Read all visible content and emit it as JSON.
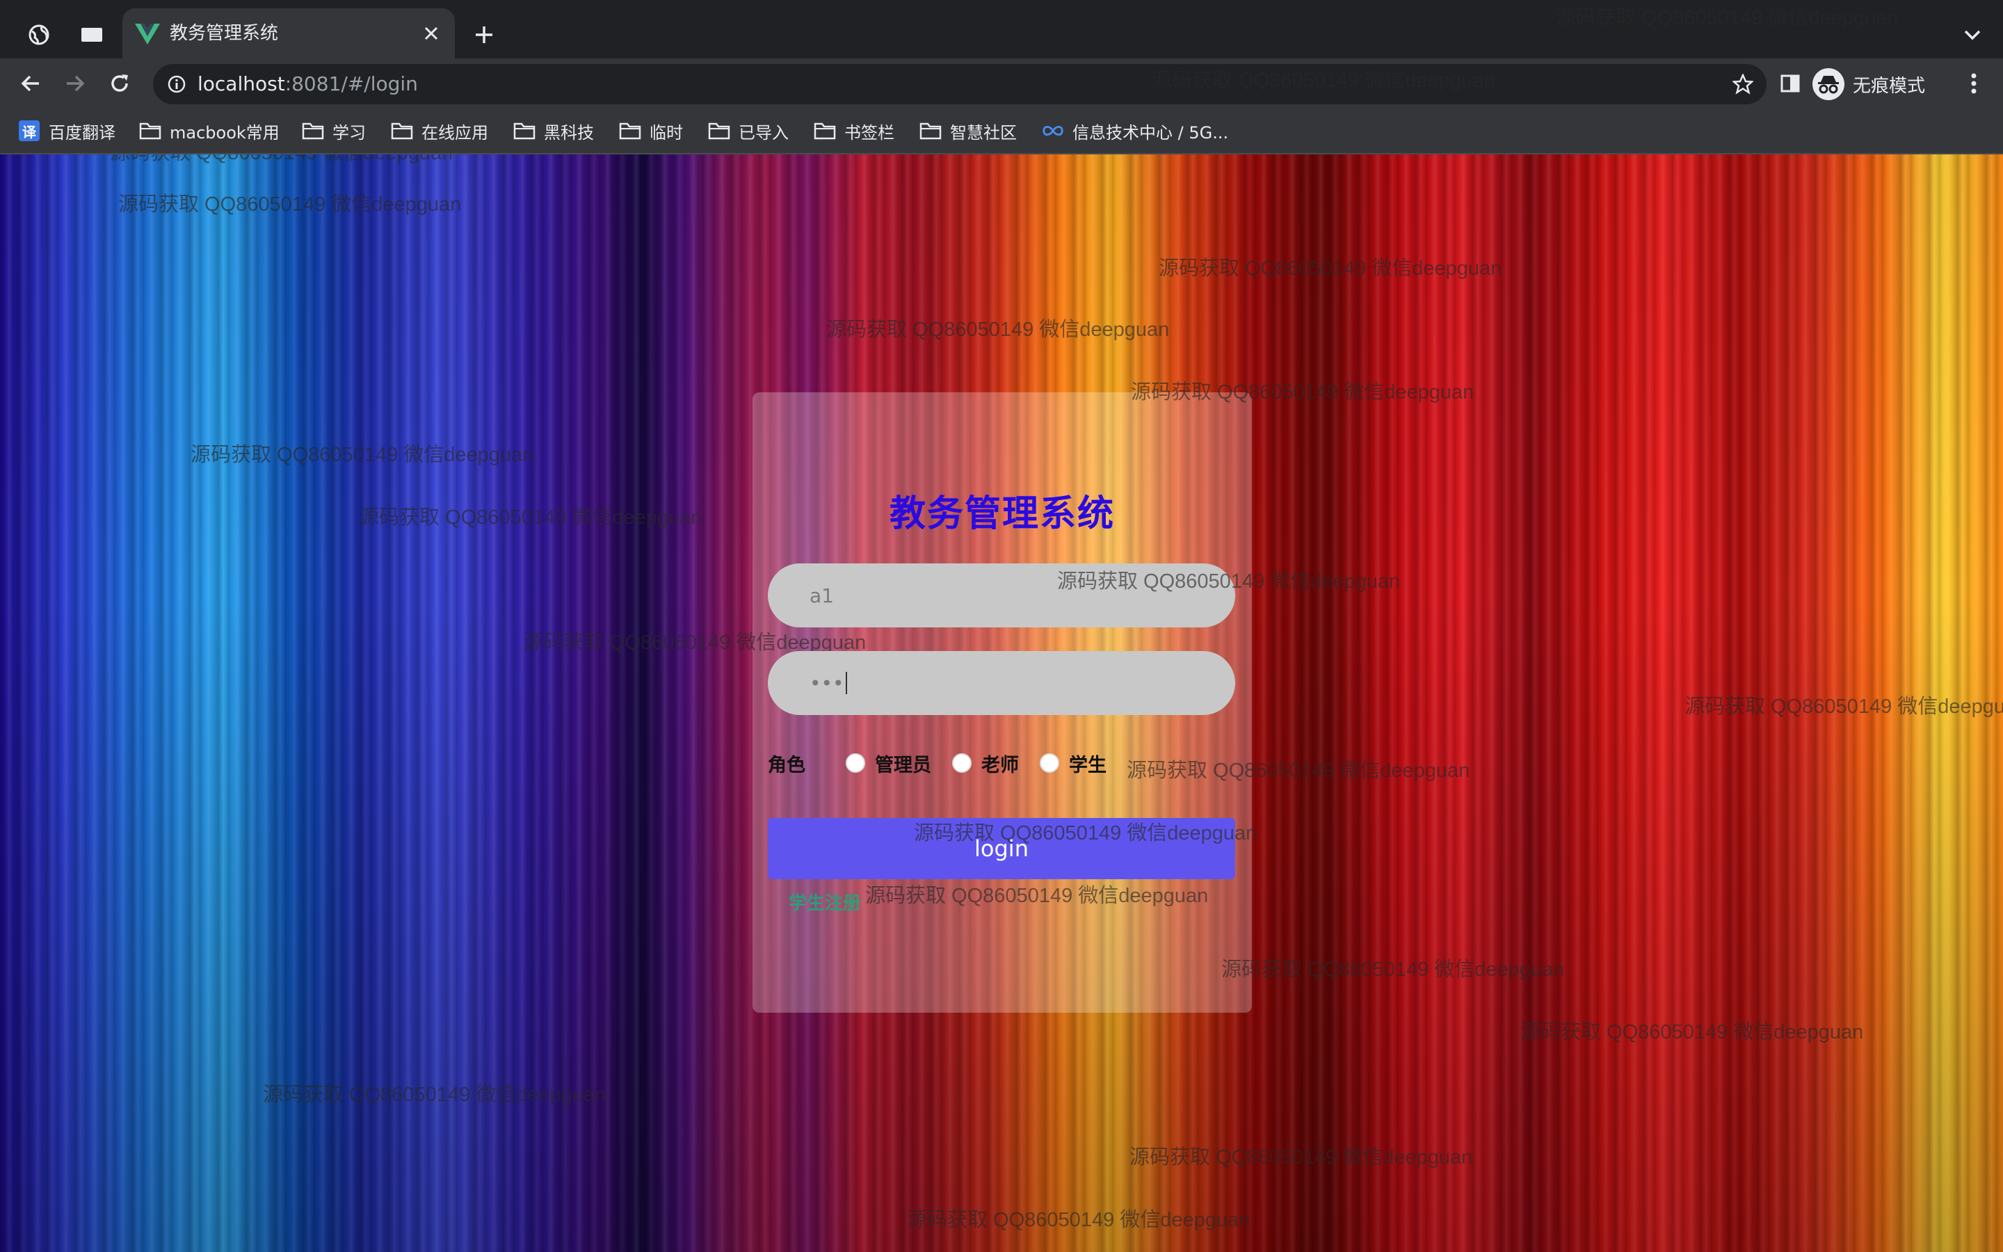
{
  "browser": {
    "tab_title": "教务管理系统",
    "new_tab": "+",
    "url_host": "localhost",
    "url_rest": ":8081/#/login",
    "incognito_label": "无痕模式"
  },
  "bookmarks": [
    {
      "label": "百度翻译",
      "icon": "translate-icon"
    },
    {
      "label": "macbook常用",
      "icon": "folder-icon"
    },
    {
      "label": "学习",
      "icon": "folder-icon"
    },
    {
      "label": "在线应用",
      "icon": "folder-icon"
    },
    {
      "label": "黑科技",
      "icon": "folder-icon"
    },
    {
      "label": "临时",
      "icon": "folder-icon"
    },
    {
      "label": "已导入",
      "icon": "folder-icon"
    },
    {
      "label": "书签栏",
      "icon": "folder-icon"
    },
    {
      "label": "智慧社区",
      "icon": "folder-icon"
    },
    {
      "label": "信息技术中心 / 5G...",
      "icon": "infinity-icon"
    }
  ],
  "login": {
    "title": "教务管理系统",
    "username_value": "a1",
    "password_value": "•••",
    "role_label": "角色",
    "roles": [
      "管理员",
      "老师",
      "学生"
    ],
    "login_button": "login",
    "register_link": "学生注册"
  },
  "watermark": "源码获取 QQ86050149 微信deepguan",
  "colors": {
    "title": "#2a0ae0",
    "button": "#5f55ee",
    "register": "#2e9c7a"
  }
}
